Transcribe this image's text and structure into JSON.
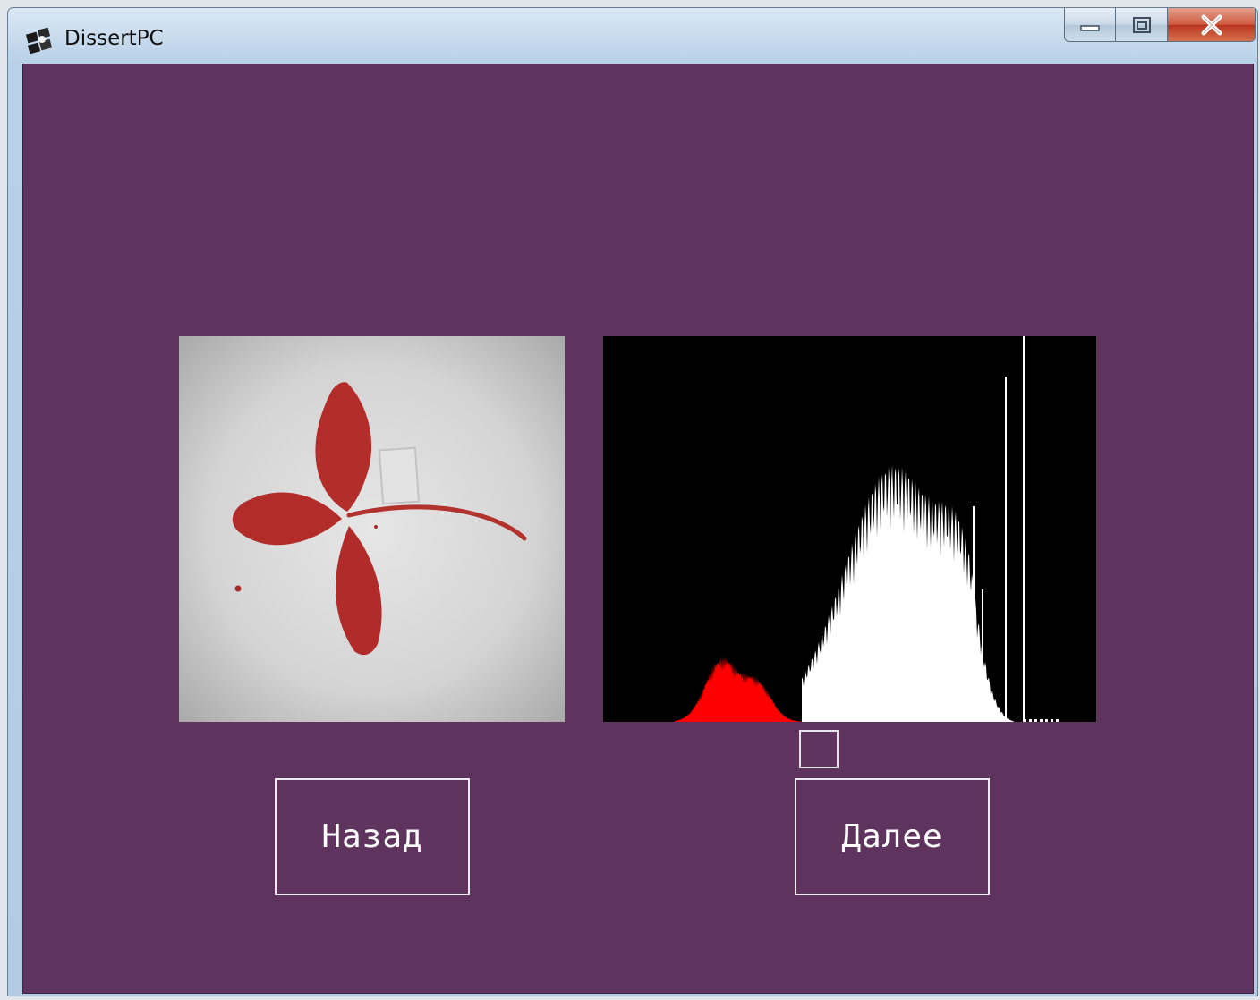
{
  "window": {
    "title": "DissertPC",
    "app_icon": "app-logo-icon",
    "controls": [
      "minimize-icon",
      "maximize-icon",
      "close-icon"
    ]
  },
  "main": {
    "source_image": {
      "description_icon": "leaf-photo"
    },
    "histogram": {
      "icon": "histogram-chart",
      "foreground_color": "#ffffff",
      "selected_color": "#ff0000",
      "background_color": "#000000"
    },
    "back_button": {
      "label": "Назад"
    },
    "next_button": {
      "label": "Далее"
    }
  },
  "colors": {
    "client_background": "#5e335e",
    "button_border": "#efe9f1",
    "button_text": "#ffffff"
  }
}
